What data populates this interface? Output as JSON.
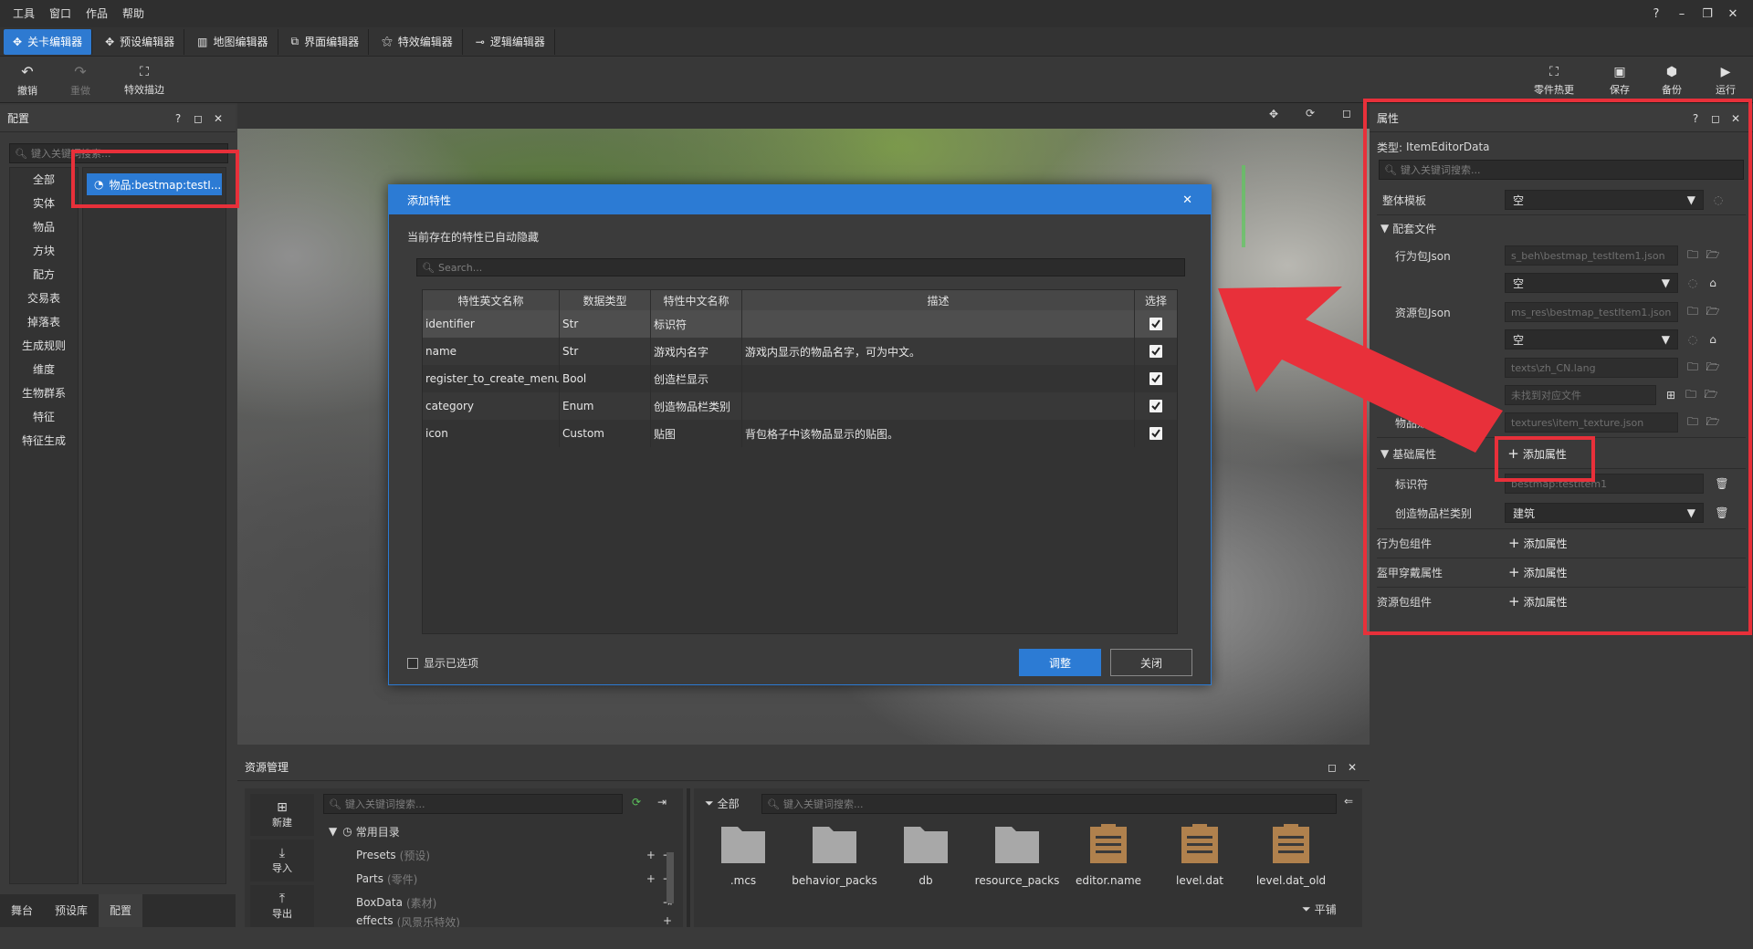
{
  "menubar": {
    "items": [
      "工具",
      "窗口",
      "作品",
      "帮助"
    ],
    "help_glyph": "?",
    "win_buttons": [
      "–",
      "❐",
      "✕"
    ]
  },
  "editor_tabs": [
    {
      "label": "关卡编辑器",
      "active": true,
      "icon": "target-icon"
    },
    {
      "label": "预设编辑器",
      "active": false,
      "icon": "preset-icon"
    },
    {
      "label": "地图编辑器",
      "active": false,
      "icon": "map-icon"
    },
    {
      "label": "界面编辑器",
      "active": false,
      "icon": "ui-icon"
    },
    {
      "label": "特效编辑器",
      "active": false,
      "icon": "fx-icon"
    },
    {
      "label": "逻辑编辑器",
      "active": false,
      "icon": "logic-icon"
    }
  ],
  "toolbar": {
    "left": [
      {
        "label": "撤销",
        "icon": "undo-icon",
        "disabled": false
      },
      {
        "label": "重做",
        "icon": "redo-icon",
        "disabled": true
      },
      {
        "label": "特效描边",
        "icon": "outline-icon",
        "disabled": false
      }
    ],
    "right": [
      {
        "label": "零件热更",
        "icon": "hot-update-icon"
      },
      {
        "label": "保存",
        "icon": "save-icon"
      },
      {
        "label": "备份",
        "icon": "backup-icon"
      },
      {
        "label": "运行",
        "icon": "play-icon"
      }
    ]
  },
  "left_panel": {
    "title": "配置",
    "search_placeholder": "键入关键词搜索...",
    "categories": [
      "全部",
      "实体",
      "物品",
      "方块",
      "配方",
      "交易表",
      "掉落表",
      "生成规则",
      "维度",
      "生物群系",
      "特征",
      "特征生成"
    ],
    "tree_item": "物品:bestmap:testI...",
    "bottom_tabs": [
      "舞台",
      "预设库",
      "配置"
    ],
    "active_bottom_tab": "配置"
  },
  "dialog": {
    "title": "添加特性",
    "note": "当前存在的特性已自动隐藏",
    "search_placeholder": "Search...",
    "columns": [
      "特性英文名称",
      "数据类型",
      "特性中文名称",
      "描述",
      "选择"
    ],
    "rows": [
      {
        "en": "identifier",
        "type": "Str",
        "cn": "标识符",
        "desc": "",
        "checked": true
      },
      {
        "en": "name",
        "type": "Str",
        "cn": "游戏内名字",
        "desc": "游戏内显示的物品名字，可为中文。",
        "checked": true
      },
      {
        "en": "register_to_create_menu",
        "type": "Bool",
        "cn": "创造栏显示",
        "desc": "",
        "checked": true
      },
      {
        "en": "category",
        "type": "Enum",
        "cn": "创造物品栏类别",
        "desc": "",
        "checked": true
      },
      {
        "en": "icon",
        "type": "Custom",
        "cn": "贴图",
        "desc": "背包格子中该物品显示的贴图。",
        "checked": true
      }
    ],
    "show_selected_label": "显示已选项",
    "confirm_label": "调整",
    "close_label": "关闭"
  },
  "right_panel": {
    "title": "属性",
    "type_label": "类型:",
    "type_value": "ItemEditorData",
    "search_placeholder": "键入关键词搜索...",
    "template_label": "整体模板",
    "template_value": "空",
    "files_section": "配套文件",
    "behavior_json_label": "行为包Json",
    "behavior_json_path": "s_beh\\bestmap_testItem1.json",
    "behavior_select": "空",
    "resource_json_label": "资源包Json",
    "resource_json_path": "ms_res\\bestmap_testItem1.json",
    "resource_select": "空",
    "lang_path": "texts\\zh_CN.lang",
    "not_found_path": "未找到对应文件",
    "item_tex_label": "物品贴",
    "item_tex_path": "textures\\item_texture.json",
    "basic_section": "基础属性",
    "add_prop_label": "添加属性",
    "identifier_label": "标识符",
    "identifier_value": "bestmap:testItem1",
    "category_label": "创造物品栏类别",
    "category_value": "建筑",
    "behavior_components": "行为包组件",
    "armor_props": "盔甲穿戴属性",
    "resource_components": "资源包组件"
  },
  "resource_manager": {
    "title": "资源管理",
    "buttons": [
      {
        "label": "新建",
        "icon": "new-file-icon"
      },
      {
        "label": "导入",
        "icon": "import-icon"
      },
      {
        "label": "导出",
        "icon": "export-icon"
      }
    ],
    "search_placeholder": "键入关键词搜索...",
    "tree_root": "常用目录",
    "tree_items": [
      {
        "name": "Presets",
        "sub": "(预设)"
      },
      {
        "name": "Parts",
        "sub": "(零件)"
      },
      {
        "name": "BoxData",
        "sub": "(素材)"
      },
      {
        "name": "effects",
        "sub": "(风景乐特效)"
      }
    ],
    "filter_label": "全部",
    "files_search_placeholder": "键入关键词搜索...",
    "files": [
      {
        "name": ".mcs",
        "kind": "folder"
      },
      {
        "name": "behavior_packs",
        "kind": "folder"
      },
      {
        "name": "db",
        "kind": "folder"
      },
      {
        "name": "resource_packs",
        "kind": "folder"
      },
      {
        "name": "editor.name",
        "kind": "doc"
      },
      {
        "name": "level.dat",
        "kind": "doc"
      },
      {
        "name": "level.dat_old",
        "kind": "doc"
      }
    ],
    "view_mode_label": "平铺"
  },
  "colors": {
    "accent": "#2c7bd4",
    "annotation_red": "#e8303a",
    "doc_brown": "#b0814d",
    "folder_grey": "#a8a8a8"
  }
}
